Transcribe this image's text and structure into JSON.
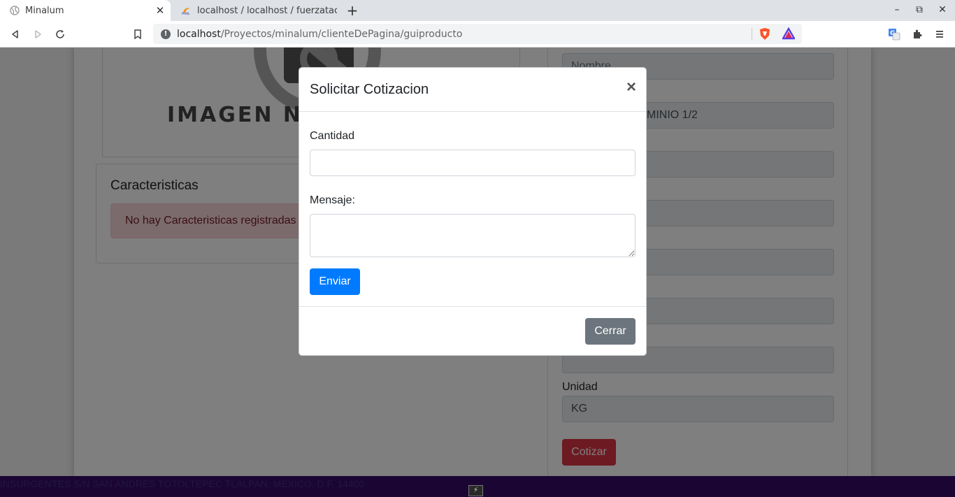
{
  "browser": {
    "tabs": [
      {
        "title": "Minalum",
        "favicon": "globe-icon",
        "active": true
      },
      {
        "title": "localhost / localhost / fuerzatac",
        "favicon": "phpmyadmin-icon",
        "active": false
      }
    ],
    "new_tab": "+",
    "window_controls": {
      "minimize": "–",
      "restore": "⧉",
      "close": "✕"
    },
    "address": {
      "host": "localhost",
      "path": "/Proyectos/minalum/clienteDePagina/guiproducto"
    }
  },
  "page": {
    "no_image_text": "IMAGEN NO",
    "characteristics": {
      "title": "Caracteristicas",
      "empty_alert": "No hay Caracteristicas registradas"
    },
    "product_form": {
      "nombre_placeholder": "Nombre",
      "product_value": "MINIO 1/2",
      "unidad_label": "Unidad",
      "unidad_value": "KG",
      "cotizar_label": "Cotizar"
    },
    "footer_text": "INSURGENTES S/N SAN ANDRES TOTOLTEPEC TLALPAN, MEXICO, D.F. 14400"
  },
  "modal": {
    "title": "Solicitar Cotizacion",
    "close_symbol": "×",
    "cantidad_label": "Cantidad",
    "cantidad_value": "",
    "mensaje_label": "Mensaje:",
    "mensaje_value": "",
    "enviar_label": "Enviar",
    "cerrar_label": "Cerrar"
  }
}
